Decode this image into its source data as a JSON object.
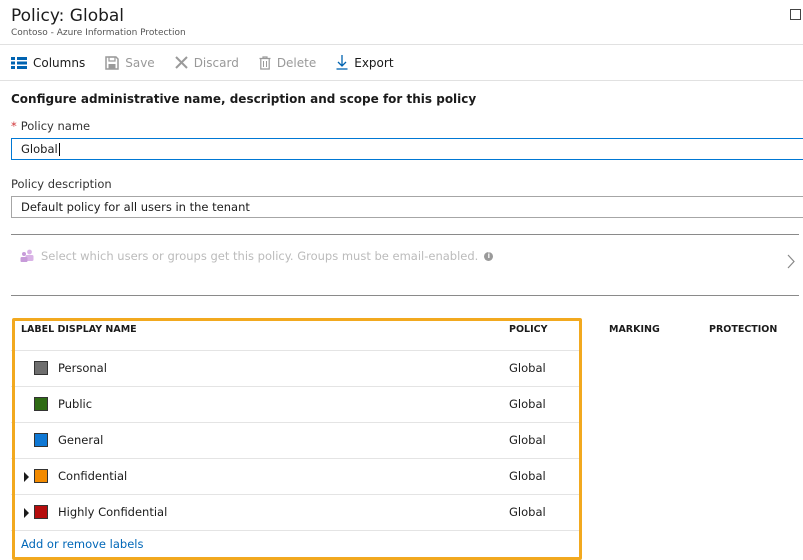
{
  "header": {
    "title": "Policy: Global",
    "subtitle": "Contoso - Azure Information Protection"
  },
  "toolbar": {
    "columns": "Columns",
    "save": "Save",
    "discard": "Discard",
    "delete": "Delete",
    "export": "Export"
  },
  "form": {
    "section_title": "Configure administrative name, description and scope for this policy",
    "required_marker": "*",
    "name_label": "Policy name",
    "name_value": "Global",
    "description_label": "Policy description",
    "description_value": "Default policy for all users in the tenant",
    "scope_text": "Select which users or groups get this policy. Groups must be email-enabled.",
    "info_glyph": "i"
  },
  "table": {
    "headers": {
      "label_display_name": "LABEL DISPLAY NAME",
      "policy": "POLICY",
      "marking": "MARKING",
      "protection": "PROTECTION"
    },
    "rows": [
      {
        "name": "Personal",
        "policy": "Global",
        "color": "#6e6e6e",
        "has_children": false
      },
      {
        "name": "Public",
        "policy": "Global",
        "color": "#2e6b14",
        "has_children": false
      },
      {
        "name": "General",
        "policy": "Global",
        "color": "#0f78d4",
        "has_children": false
      },
      {
        "name": "Confidential",
        "policy": "Global",
        "color": "#f28a00",
        "has_children": true
      },
      {
        "name": "Highly Confidential",
        "policy": "Global",
        "color": "#b50d0d",
        "has_children": true
      }
    ],
    "add_link": "Add or remove labels"
  },
  "colors": {
    "accent": "#0078d4",
    "highlight": "#f2a91f",
    "link": "#0067b8"
  }
}
